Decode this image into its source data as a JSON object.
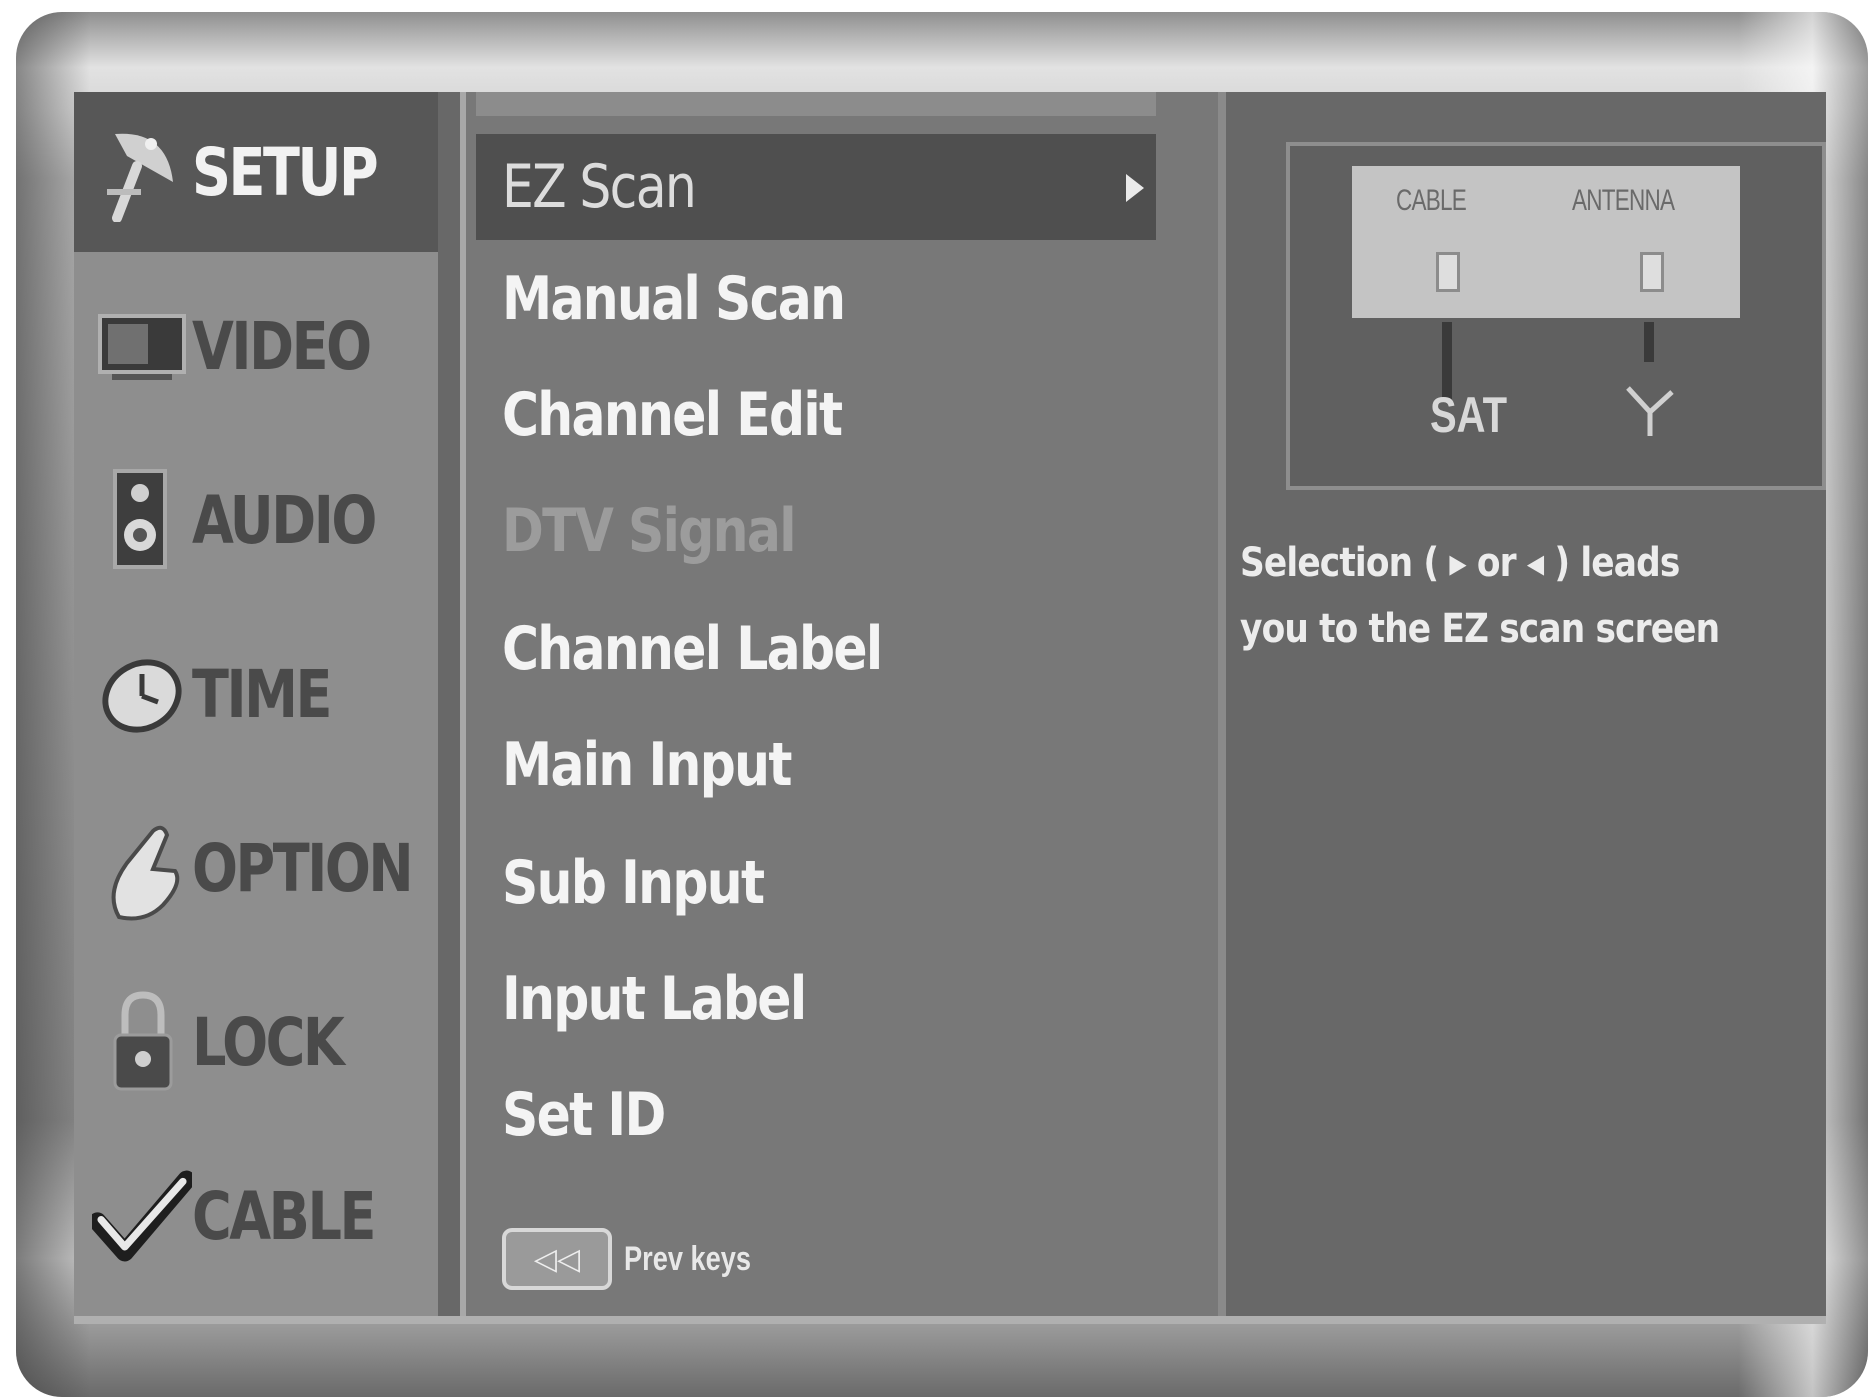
{
  "categories": [
    {
      "label": "SETUP",
      "icon": "satellite-dish-icon",
      "active": true
    },
    {
      "label": "VIDEO",
      "icon": "tv-icon",
      "active": false
    },
    {
      "label": "AUDIO",
      "icon": "speaker-icon",
      "active": false
    },
    {
      "label": "TIME",
      "icon": "clock-icon",
      "active": false
    },
    {
      "label": "OPTION",
      "icon": "hand-pointer-icon",
      "active": false
    },
    {
      "label": "LOCK",
      "icon": "padlock-icon",
      "active": false
    },
    {
      "label": "CABLE",
      "icon": "checkmark-icon",
      "active": false
    }
  ],
  "menu": {
    "items": [
      {
        "label": "EZ Scan",
        "state": "selected"
      },
      {
        "label": "Manual Scan",
        "state": "normal"
      },
      {
        "label": "Channel Edit",
        "state": "normal"
      },
      {
        "label": "DTV Signal",
        "state": "disabled"
      },
      {
        "label": "Channel Label",
        "state": "normal"
      },
      {
        "label": "Main Input",
        "state": "normal"
      },
      {
        "label": "Sub Input",
        "state": "normal"
      },
      {
        "label": "Input Label",
        "state": "normal"
      },
      {
        "label": "Set ID",
        "state": "normal"
      }
    ],
    "prev_keys": {
      "key_label": "◁◁",
      "label": "Prev keys"
    }
  },
  "help": {
    "diagram": {
      "left_port": "CABLE",
      "right_port": "ANTENNA",
      "left_source": "SAT",
      "right_source": "antenna-icon"
    },
    "description": "Selection ( ▸ or ◂ ) leads you to the EZ scan screen"
  },
  "colors": {
    "screen_bg": "#686868",
    "category_bg": "#8e8e8e",
    "category_active": "#575757",
    "menu_bg": "#787878",
    "menu_active": "#4f4f4f",
    "text_light": "#f4f4f4"
  }
}
